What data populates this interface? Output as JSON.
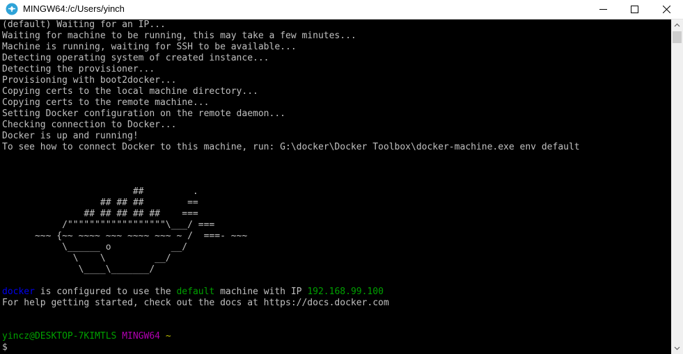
{
  "window": {
    "title": "MINGW64:/c/Users/yinch",
    "icon": "mingw-app-icon",
    "controls": [
      "minimize-icon",
      "maximize-icon",
      "close-icon"
    ]
  },
  "colors": {
    "background": "#000000",
    "text": "#c0c0c0",
    "blue": "#0000ee",
    "green": "#00a000",
    "magenta": "#b000b0",
    "yellow": "#c0c000"
  },
  "terminal": {
    "output_lines": [
      "(default) Waiting for an IP...",
      "Waiting for machine to be running, this may take a few minutes...",
      "Machine is running, waiting for SSH to be available...",
      "Detecting operating system of created instance...",
      "Detecting the provisioner...",
      "Provisioning with boot2docker...",
      "Copying certs to the local machine directory...",
      "Copying certs to the remote machine...",
      "Setting Docker configuration on the remote daemon...",
      "Checking connection to Docker...",
      "Docker is up and running!",
      "To see how to connect Docker to this machine, run: G:\\docker\\Docker Toolbox\\docker-machine.exe env default"
    ],
    "ascii_whale": [
      "                        ##         .",
      "                  ## ## ##        ==",
      "               ## ## ## ## ##    ===",
      "           /\"\"\"\"\"\"\"\"\"\"\"\"\"\"\"\"\"\"\\___/ ===",
      "      ~~~ {~~ ~~~~ ~~~ ~~~~ ~~~ ~ /  ===- ~~~",
      "           \\______ o           __/",
      "             \\    \\         __/",
      "              \\____\\_______/"
    ],
    "status_line": {
      "name": "docker",
      "text1": " is configured to use the ",
      "machine": "default",
      "text2": " machine with IP ",
      "ip": "192.168.99.100"
    },
    "help_line": "For help getting started, check out the docs at https://docs.docker.com",
    "prompt": {
      "user_host": "yincz@DESKTOP-7KIMTLS",
      "space1": " ",
      "env": "MINGW64",
      "space2": " ",
      "path": "~",
      "symbol": "$"
    }
  }
}
